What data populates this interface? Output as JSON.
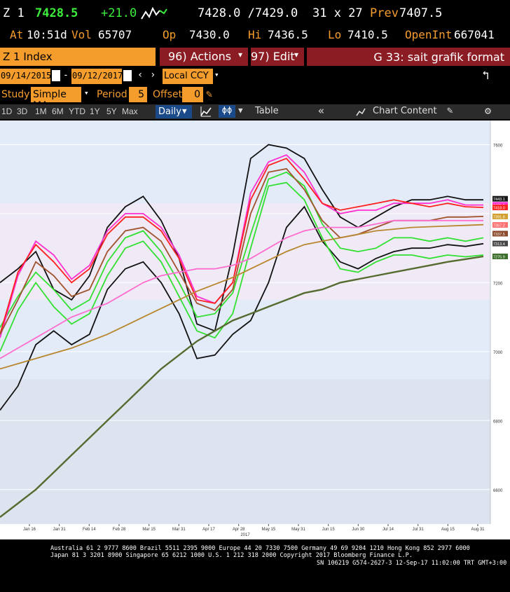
{
  "quote": {
    "ticker": "Z 1",
    "last": "7428.5",
    "change": "+21.0",
    "bid_ask": "7428.0 /7429.0",
    "size": "31 x 27",
    "prev_label": "Prev",
    "prev": "7407.5",
    "at_label": "At",
    "time": "10:51d",
    "vol_label": "Vol",
    "vol": "65707",
    "op_label": "Op",
    "op": "7430.0",
    "hi_label": "Hi",
    "hi": "7436.5",
    "lo_label": "Lo",
    "lo": "7410.5",
    "oi_label": "OpenInt",
    "oi": "667041"
  },
  "toolbar": {
    "security": "Z 1 Index",
    "actions": "96) Actions",
    "edit": "97) Edit",
    "page_title": "G 33: sait grafik format"
  },
  "dates": {
    "start": "09/14/2015",
    "end": "09/12/2017",
    "currency": "Local CCY"
  },
  "study": {
    "label": "Study",
    "value": "Simple MA",
    "period_label": "Period",
    "period": "5",
    "offset_label": "Offset",
    "offset": "0"
  },
  "ranges": [
    "1D",
    "3D",
    "1M",
    "6M",
    "YTD",
    "1Y",
    "5Y",
    "Max"
  ],
  "frequency": "Daily",
  "table_label": "Table",
  "chart_content_label": "Chart Content",
  "colors": {
    "amber": "#f49c2c",
    "red_bar": "#8b1c24",
    "chart_bg": "#e4ecfa",
    "band": "#f0ecf6",
    "line_pink": "#ff30d0",
    "line_red": "#ff2020",
    "line_green": "#32e032",
    "line_brown": "#a0522d",
    "line_black": "#111111",
    "line_olive": "#556b2f"
  },
  "chart_data": {
    "type": "line",
    "x_ticks": [
      "Jan 16",
      "Jan 31",
      "Feb 14",
      "Feb 28",
      "Mar 15",
      "Mar 31",
      "Apr 17",
      "Apr 28",
      "May 15",
      "May 31",
      "Jun 15",
      "Jun 30",
      "Jul 14",
      "Jul 31",
      "Aug 15",
      "Aug 31"
    ],
    "year_label": "2017",
    "y_ticks": [
      "7600",
      "7200",
      "7000",
      "6800",
      "6600"
    ],
    "ylim": [
      6500,
      7670
    ],
    "last_value_tags": [
      {
        "text": "7443.1",
        "color": "#1a1a1a",
        "y": 7443.1
      },
      {
        "text": "7425.5",
        "color": "#ff30d0",
        "y": 7425.5
      },
      {
        "text": "7418.0",
        "color": "#ff2020",
        "y": 7418.0
      },
      {
        "text": "7391.8",
        "color": "#d2a030",
        "y": 7391.8
      },
      {
        "text": "7367.2",
        "color": "#ff7070",
        "y": 7367.2
      },
      {
        "text": "7337.5",
        "color": "#8b4a2b",
        "y": 7342.0
      },
      {
        "text": "7313.4",
        "color": "#444444",
        "y": 7313.4
      },
      {
        "text": "7275.9",
        "color": "#3a6e2a",
        "y": 7275.9
      }
    ],
    "series": [
      {
        "color": "#111111",
        "values": [
          7200,
          7240,
          7290,
          7180,
          7150,
          7220,
          7360,
          7420,
          7450,
          7380,
          7270,
          7080,
          7060,
          7280,
          7560,
          7600,
          7590,
          7560,
          7470,
          7390,
          7360,
          7390,
          7420,
          7440,
          7440,
          7450,
          7440,
          7440
        ]
      },
      {
        "color": "#111111",
        "values": [
          6830,
          6900,
          7020,
          7060,
          7020,
          7050,
          7180,
          7240,
          7260,
          7200,
          7110,
          6980,
          6990,
          7050,
          7090,
          7200,
          7360,
          7420,
          7320,
          7260,
          7240,
          7270,
          7290,
          7300,
          7300,
          7310,
          7305,
          7313
        ]
      },
      {
        "color": "#32e032",
        "values": [
          7070,
          7160,
          7230,
          7180,
          7120,
          7150,
          7260,
          7330,
          7350,
          7290,
          7200,
          7100,
          7110,
          7170,
          7340,
          7500,
          7520,
          7480,
          7370,
          7300,
          7290,
          7300,
          7330,
          7330,
          7320,
          7330,
          7320,
          7330
        ]
      },
      {
        "color": "#32e032",
        "values": [
          7000,
          7120,
          7200,
          7130,
          7080,
          7110,
          7220,
          7300,
          7320,
          7260,
          7160,
          7060,
          7040,
          7110,
          7300,
          7480,
          7490,
          7440,
          7330,
          7240,
          7230,
          7260,
          7280,
          7280,
          7270,
          7280,
          7275,
          7280
        ]
      },
      {
        "color": "#ff30d0",
        "values": [
          7040,
          7220,
          7320,
          7280,
          7210,
          7250,
          7350,
          7400,
          7400,
          7360,
          7280,
          7160,
          7140,
          7200,
          7460,
          7550,
          7570,
          7520,
          7430,
          7400,
          7410,
          7410,
          7430,
          7430,
          7430,
          7440,
          7425,
          7425
        ]
      },
      {
        "color": "#ff2020",
        "values": [
          7050,
          7230,
          7310,
          7260,
          7200,
          7240,
          7340,
          7390,
          7390,
          7350,
          7270,
          7150,
          7140,
          7200,
          7440,
          7540,
          7560,
          7500,
          7430,
          7410,
          7420,
          7430,
          7440,
          7430,
          7420,
          7430,
          7420,
          7418
        ]
      },
      {
        "color": "#a0522d",
        "values": [
          7050,
          7150,
          7260,
          7220,
          7160,
          7180,
          7290,
          7350,
          7360,
          7320,
          7230,
          7140,
          7120,
          7180,
          7400,
          7520,
          7530,
          7470,
          7380,
          7330,
          7340,
          7360,
          7380,
          7380,
          7380,
          7390,
          7390,
          7392
        ]
      },
      {
        "color": "#ff6ecf",
        "values": [
          6980,
          7010,
          7040,
          7070,
          7100,
          7120,
          7140,
          7170,
          7200,
          7220,
          7230,
          7240,
          7240,
          7250,
          7270,
          7300,
          7330,
          7350,
          7360,
          7360,
          7360,
          7370,
          7380,
          7380,
          7380,
          7380,
          7380,
          7380
        ]
      },
      {
        "color": "#b8862e",
        "values": [
          6950,
          6965,
          6980,
          6995,
          7010,
          7030,
          7050,
          7075,
          7100,
          7125,
          7150,
          7175,
          7195,
          7215,
          7240,
          7265,
          7290,
          7310,
          7320,
          7330,
          7340,
          7350,
          7355,
          7360,
          7362,
          7364,
          7366,
          7368
        ]
      },
      {
        "color": "#556b2f",
        "values": [
          6520,
          6560,
          6600,
          6650,
          6700,
          6750,
          6800,
          6850,
          6900,
          6950,
          6990,
          7030,
          7060,
          7090,
          7110,
          7130,
          7150,
          7170,
          7180,
          7200,
          7210,
          7220,
          7230,
          7240,
          7250,
          7260,
          7268,
          7276
        ]
      }
    ]
  },
  "footer": {
    "line1": "Australia 61 2 9777 8600 Brazil 5511 2395 9000 Europe 44 20 7330 7500 Germany 49 69 9204 1210 Hong Kong 852 2977 6000",
    "line2": "Japan 81 3 3201 8900      Singapore 65 6212 1000       U.S. 1 212 318 2000          Copyright 2017 Bloomberg Finance L.P.",
    "line3": "SN 106219 G574-2627-3 12-Sep-17 11:02:00 TRT  GMT+3:00"
  }
}
